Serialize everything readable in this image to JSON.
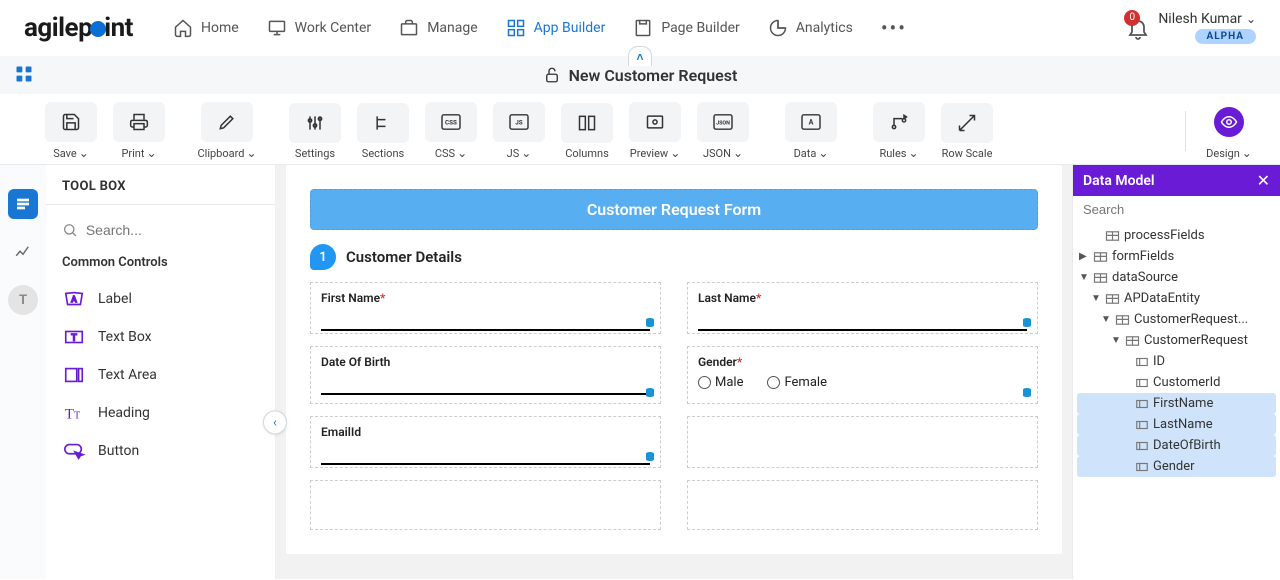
{
  "brand": "agilepoint",
  "nav": {
    "home": "Home",
    "workcenter": "Work Center",
    "manage": "Manage",
    "appbuilder": "App Builder",
    "pagebuilder": "Page Builder",
    "analytics": "Analytics"
  },
  "user": {
    "name": "Nilesh Kumar",
    "badge": "0",
    "env": "ALPHA"
  },
  "subheader": {
    "title": "New Customer Request"
  },
  "toolbar": {
    "save": "Save",
    "print": "Print",
    "clipboard": "Clipboard",
    "settings": "Settings",
    "sections": "Sections",
    "css": "CSS",
    "js": "JS",
    "columns": "Columns",
    "preview": "Preview",
    "json": "JSON",
    "data": "Data",
    "rules": "Rules",
    "rowscale": "Row Scale",
    "design": "Design"
  },
  "toolbox": {
    "title": "TOOL BOX",
    "search_placeholder": "Search...",
    "group_common": "Common Controls",
    "items": {
      "label": "Label",
      "textbox": "Text Box",
      "textarea": "Text Area",
      "heading": "Heading",
      "button": "Button"
    }
  },
  "form": {
    "title": "Customer Request Form",
    "section1_num": "1",
    "section1_name": "Customer Details",
    "firstname": "First Name",
    "lastname": "Last Name",
    "dob": "Date Of Birth",
    "gender": "Gender",
    "male": "Male",
    "female": "Female",
    "email": "EmailId"
  },
  "dm": {
    "title": "Data Model",
    "search_placeholder": "Search",
    "nodes": {
      "processFields": "processFields",
      "formFields": "formFields",
      "dataSource": "dataSource",
      "apdata": "APDataEntity",
      "crEllip": "CustomerRequest...",
      "cr": "CustomerRequest",
      "id": "ID",
      "custid": "CustomerId",
      "first": "FirstName",
      "last": "LastName",
      "dob": "DateOfBirth",
      "gender": "Gender"
    }
  }
}
